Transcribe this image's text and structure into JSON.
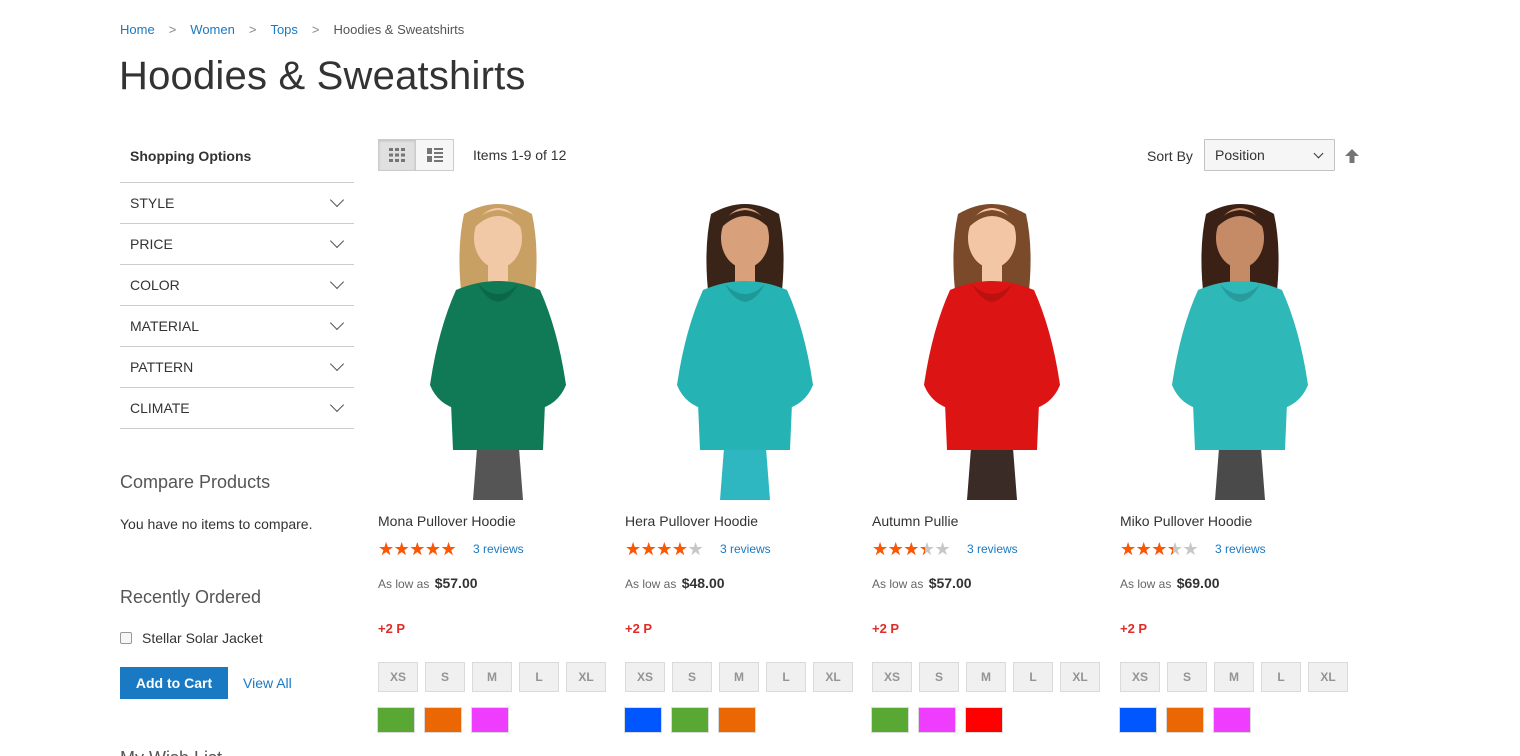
{
  "breadcrumb": {
    "home": "Home",
    "women": "Women",
    "tops": "Tops",
    "current": "Hoodies & Sweatshirts",
    "sep": ">"
  },
  "page_title": "Hoodies & Sweatshirts",
  "sidebar": {
    "shopping_options": "Shopping Options",
    "filters": [
      "STYLE",
      "PRICE",
      "COLOR",
      "MATERIAL",
      "PATTERN",
      "CLIMATE"
    ],
    "compare_title": "Compare Products",
    "compare_text": "You have no items to compare.",
    "recent_title": "Recently Ordered",
    "recent_item": "Stellar Solar Jacket",
    "add_to_cart": "Add to Cart",
    "view_all": "View All",
    "wishlist_peek": "My Wish List"
  },
  "toolbar": {
    "items_count": "Items 1-9 of 12",
    "sort_label": "Sort By",
    "sort_value": "Position"
  },
  "colors": {
    "accent": "#1979c3",
    "star": "#ff5501",
    "points": "#e02b27"
  },
  "products": [
    {
      "name": "Mona Pullover Hoodie",
      "rating_fraction": 0.9,
      "reviews": "3 reviews",
      "price_prefix": "As low as",
      "price": "$57.00",
      "points": "+2 P",
      "sizes": [
        "XS",
        "S",
        "M",
        "L",
        "XL"
      ],
      "swatches": [
        "#5aa834",
        "#eb6703",
        "#ef3dff"
      ],
      "garment": "#0f7a55",
      "bottom": "#555555",
      "skin": "#f1c9a7",
      "hair": "#c9a064"
    },
    {
      "name": "Hera Pullover Hoodie",
      "rating_fraction": 0.7,
      "reviews": "3 reviews",
      "price_prefix": "As low as",
      "price": "$48.00",
      "points": "+2 P",
      "sizes": [
        "XS",
        "S",
        "M",
        "L",
        "XL"
      ],
      "swatches": [
        "#0056ff",
        "#5aa834",
        "#eb6703"
      ],
      "garment": "#25b3b3",
      "bottom": "#2eb7c0",
      "skin": "#d9a07c",
      "hair": "#3a2418"
    },
    {
      "name": "Autumn Pullie",
      "rating_fraction": 0.6,
      "reviews": "3 reviews",
      "price_prefix": "As low as",
      "price": "$57.00",
      "points": "+2 P",
      "sizes": [
        "XS",
        "S",
        "M",
        "L",
        "XL"
      ],
      "swatches": [
        "#5aa834",
        "#ef3dff",
        "#ff0000"
      ],
      "garment": "#dd1414",
      "bottom": "#3a2b26",
      "skin": "#f3c7a6",
      "hair": "#7a4a2a"
    },
    {
      "name": "Miko Pullover Hoodie",
      "rating_fraction": 0.6,
      "reviews": "3 reviews",
      "price_prefix": "As low as",
      "price": "$69.00",
      "points": "+2 P",
      "sizes": [
        "XS",
        "S",
        "M",
        "L",
        "XL"
      ],
      "swatches": [
        "#0056ff",
        "#eb6703",
        "#ef3dff"
      ],
      "garment": "#2fb8b8",
      "bottom": "#4a4a4a",
      "skin": "#c58a66",
      "hair": "#3b2016"
    }
  ]
}
